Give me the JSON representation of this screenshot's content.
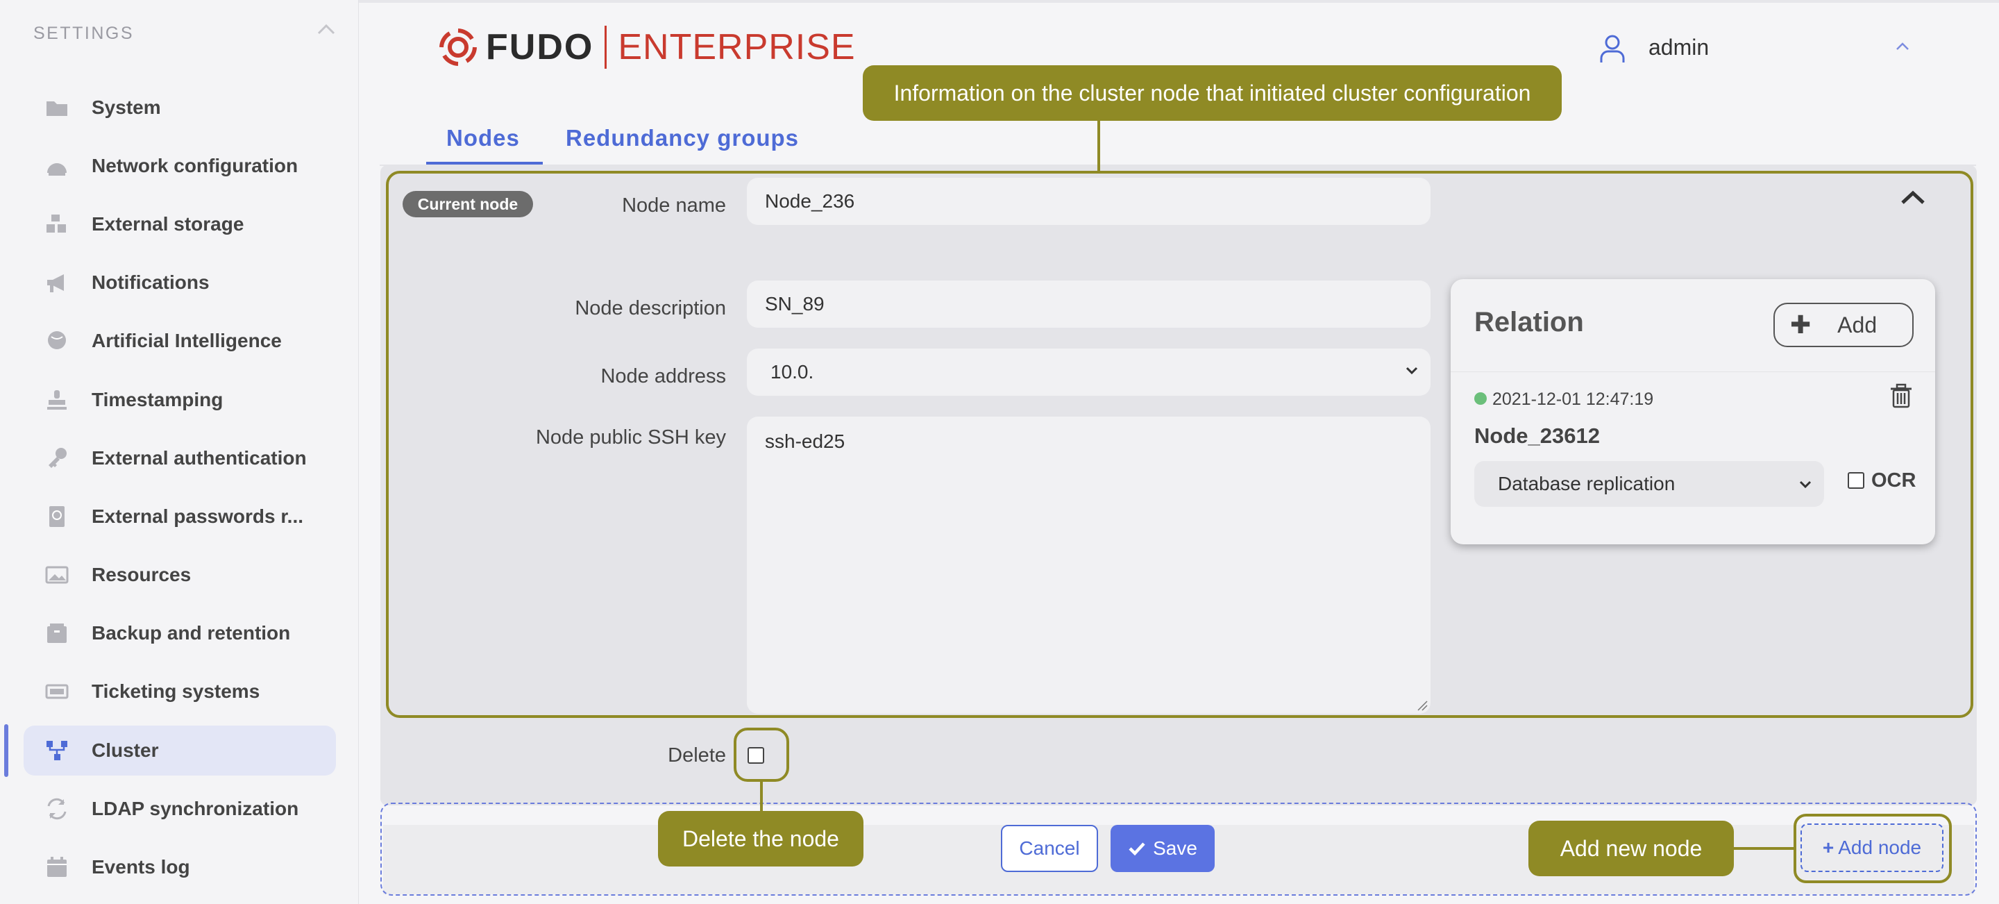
{
  "sidebar": {
    "title": "SETTINGS",
    "items": [
      {
        "label": "System",
        "icon": "folder-icon"
      },
      {
        "label": "Network configuration",
        "icon": "network-icon"
      },
      {
        "label": "External storage",
        "icon": "storage-icon"
      },
      {
        "label": "Notifications",
        "icon": "megaphone-icon"
      },
      {
        "label": "Artificial Intelligence",
        "icon": "brain-icon"
      },
      {
        "label": "Timestamping",
        "icon": "stamp-icon"
      },
      {
        "label": "External authentication",
        "icon": "key-icon"
      },
      {
        "label": "External passwords r...",
        "icon": "passport-icon"
      },
      {
        "label": "Resources",
        "icon": "image-icon"
      },
      {
        "label": "Backup and retention",
        "icon": "archive-icon"
      },
      {
        "label": "Ticketing systems",
        "icon": "ticket-icon"
      },
      {
        "label": "Cluster",
        "icon": "cluster-icon",
        "active": true
      },
      {
        "label": "LDAP synchronization",
        "icon": "sync-icon"
      },
      {
        "label": "Events log",
        "icon": "calendar-icon"
      }
    ]
  },
  "header": {
    "logo_left": "FUDO",
    "logo_right": "ENTERPRISE",
    "user": "admin"
  },
  "tabs": [
    {
      "label": "Nodes",
      "active": true
    },
    {
      "label": "Redundancy groups",
      "active": false
    }
  ],
  "node": {
    "badge": "Current node",
    "name_label": "Node name",
    "name_value": "Node_236",
    "description_label": "Node description",
    "description_value": "SN_89",
    "address_label": "Node address",
    "address_value": "10.0.",
    "ssh_label": "Node public SSH key",
    "ssh_value": "ssh-ed25",
    "delete_label": "Delete"
  },
  "relation": {
    "title": "Relation",
    "add_label": "Add",
    "timestamp": "2021-12-01 12:47:19",
    "status_color": "#6bbf7a",
    "node": "Node_23612",
    "type": "Database replication",
    "ocr_label": "OCR"
  },
  "footer": {
    "cancel_label": "Cancel",
    "save_label": "Save",
    "add_node_label": "Add node"
  },
  "callouts": {
    "info": "Information on the cluster node that initiated cluster configuration",
    "delete": "Delete the node",
    "add": "Add new node"
  },
  "colors": {
    "accent": "#4e6bd6",
    "callout": "#8f8a25",
    "brand_red": "#c93a2e"
  }
}
